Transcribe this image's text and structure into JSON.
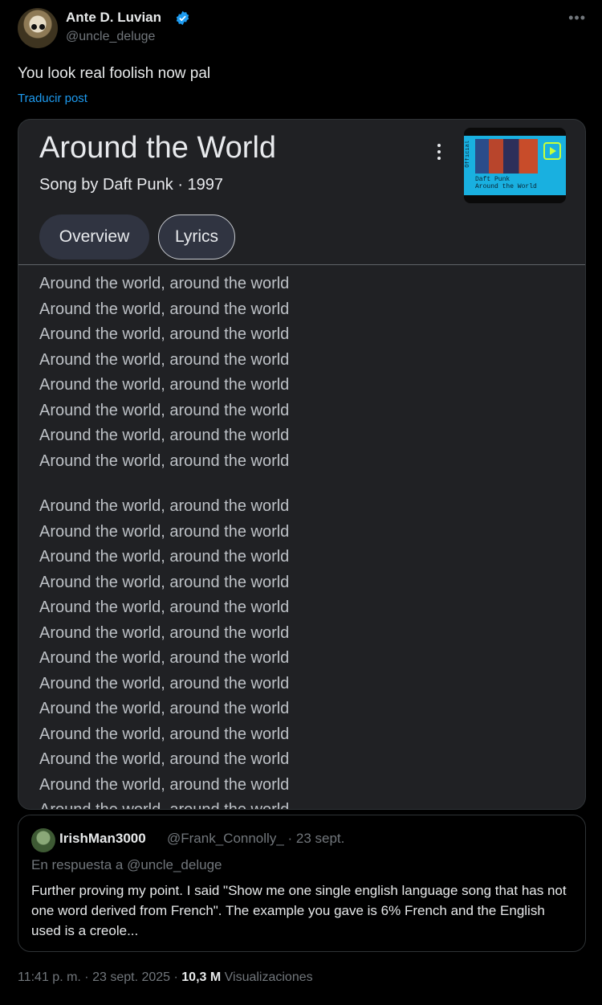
{
  "author": {
    "display_name": "Ante D. Luvian",
    "handle": "@uncle_deluge",
    "more_icon": "more-horizontal-icon"
  },
  "tweet": {
    "text": "You look real foolish now pal",
    "translate": "Traducir post"
  },
  "card": {
    "title": "Around the World",
    "subtitle": "Song by Daft Punk · 1997",
    "thumbnail": {
      "side_text": "Official",
      "caption1": "Daft Punk",
      "caption2": "Around the World"
    },
    "tabs": [
      {
        "label": "Overview"
      },
      {
        "label": "Lyrics"
      }
    ],
    "lyrics": [
      "Around the world, around the world",
      "Around the world, around the world",
      "Around the world, around the world",
      "Around the world, around the world",
      "Around the world, around the world",
      "Around the world, around the world",
      "Around the world, around the world",
      "Around the world, around the world",
      "Around the world, around the world",
      "Around the world, around the world",
      "Around the world, around the world",
      "Around the world, around the world",
      "Around the world, around the world",
      "Around the world, around the world",
      "Around the world, around the world",
      "Around the world, around the world",
      "Around the world, around the world",
      "Around the world, around the world",
      "Around the world, around the world",
      "Around the world, around the world",
      "Around the world, around the world"
    ]
  },
  "quoted": {
    "name": "IrishMan3000",
    "handle_date": "@Frank_Connolly_ · 23 sept.",
    "reply_to": "En respuesta a @uncle_deluge",
    "text": "Further proving my point. I said \"Show me one single english language song that has not one word derived from French\". The example you gave is 6% French and the English used is a creole..."
  },
  "meta": {
    "time": "11:41 p. m. · 23 sept. 2025 · ",
    "views": "10,3 M",
    "views_label": " Visualizaciones"
  },
  "colors": {
    "accent": "#1d9bf0",
    "card_bg": "#202124",
    "verified": "#1d9bf0"
  }
}
